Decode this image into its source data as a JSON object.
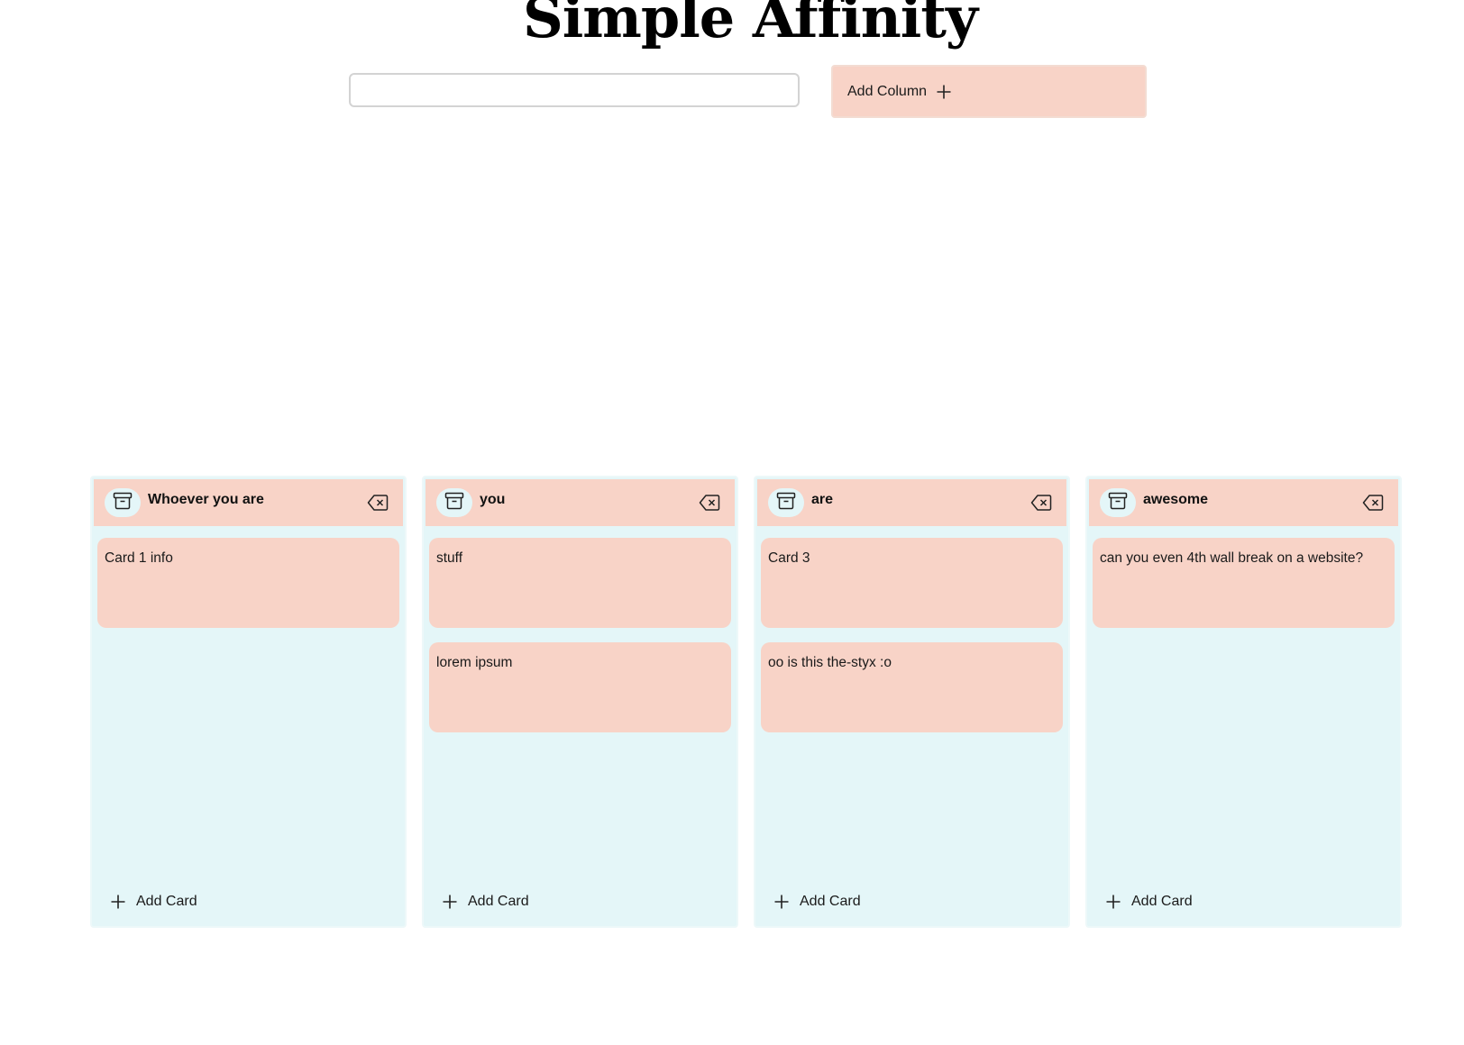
{
  "app": {
    "title": "Simple Affinity"
  },
  "toolbar": {
    "column_input_value": "",
    "add_column_label": "Add Column"
  },
  "columns": [
    {
      "title": "Whoever you are",
      "cards": [
        "Card 1 info"
      ],
      "add_card_label": "Add Card"
    },
    {
      "title": "you",
      "cards": [
        "stuff",
        "lorem ipsum"
      ],
      "add_card_label": "Add Card"
    },
    {
      "title": "are",
      "cards": [
        "Card 3",
        "oo is this the-styx :o"
      ],
      "add_card_label": "Add Card"
    },
    {
      "title": "awesome",
      "cards": [
        "can you even 4th wall break on a website?"
      ],
      "add_card_label": "Add Card"
    }
  ],
  "icons": {
    "archive": "archive-icon",
    "delete": "backspace-x-icon",
    "plus": "plus-icon"
  },
  "colors": {
    "accent_salmon": "#f8d3c7",
    "column_background": "#e4f6f8",
    "text": "#111111"
  }
}
